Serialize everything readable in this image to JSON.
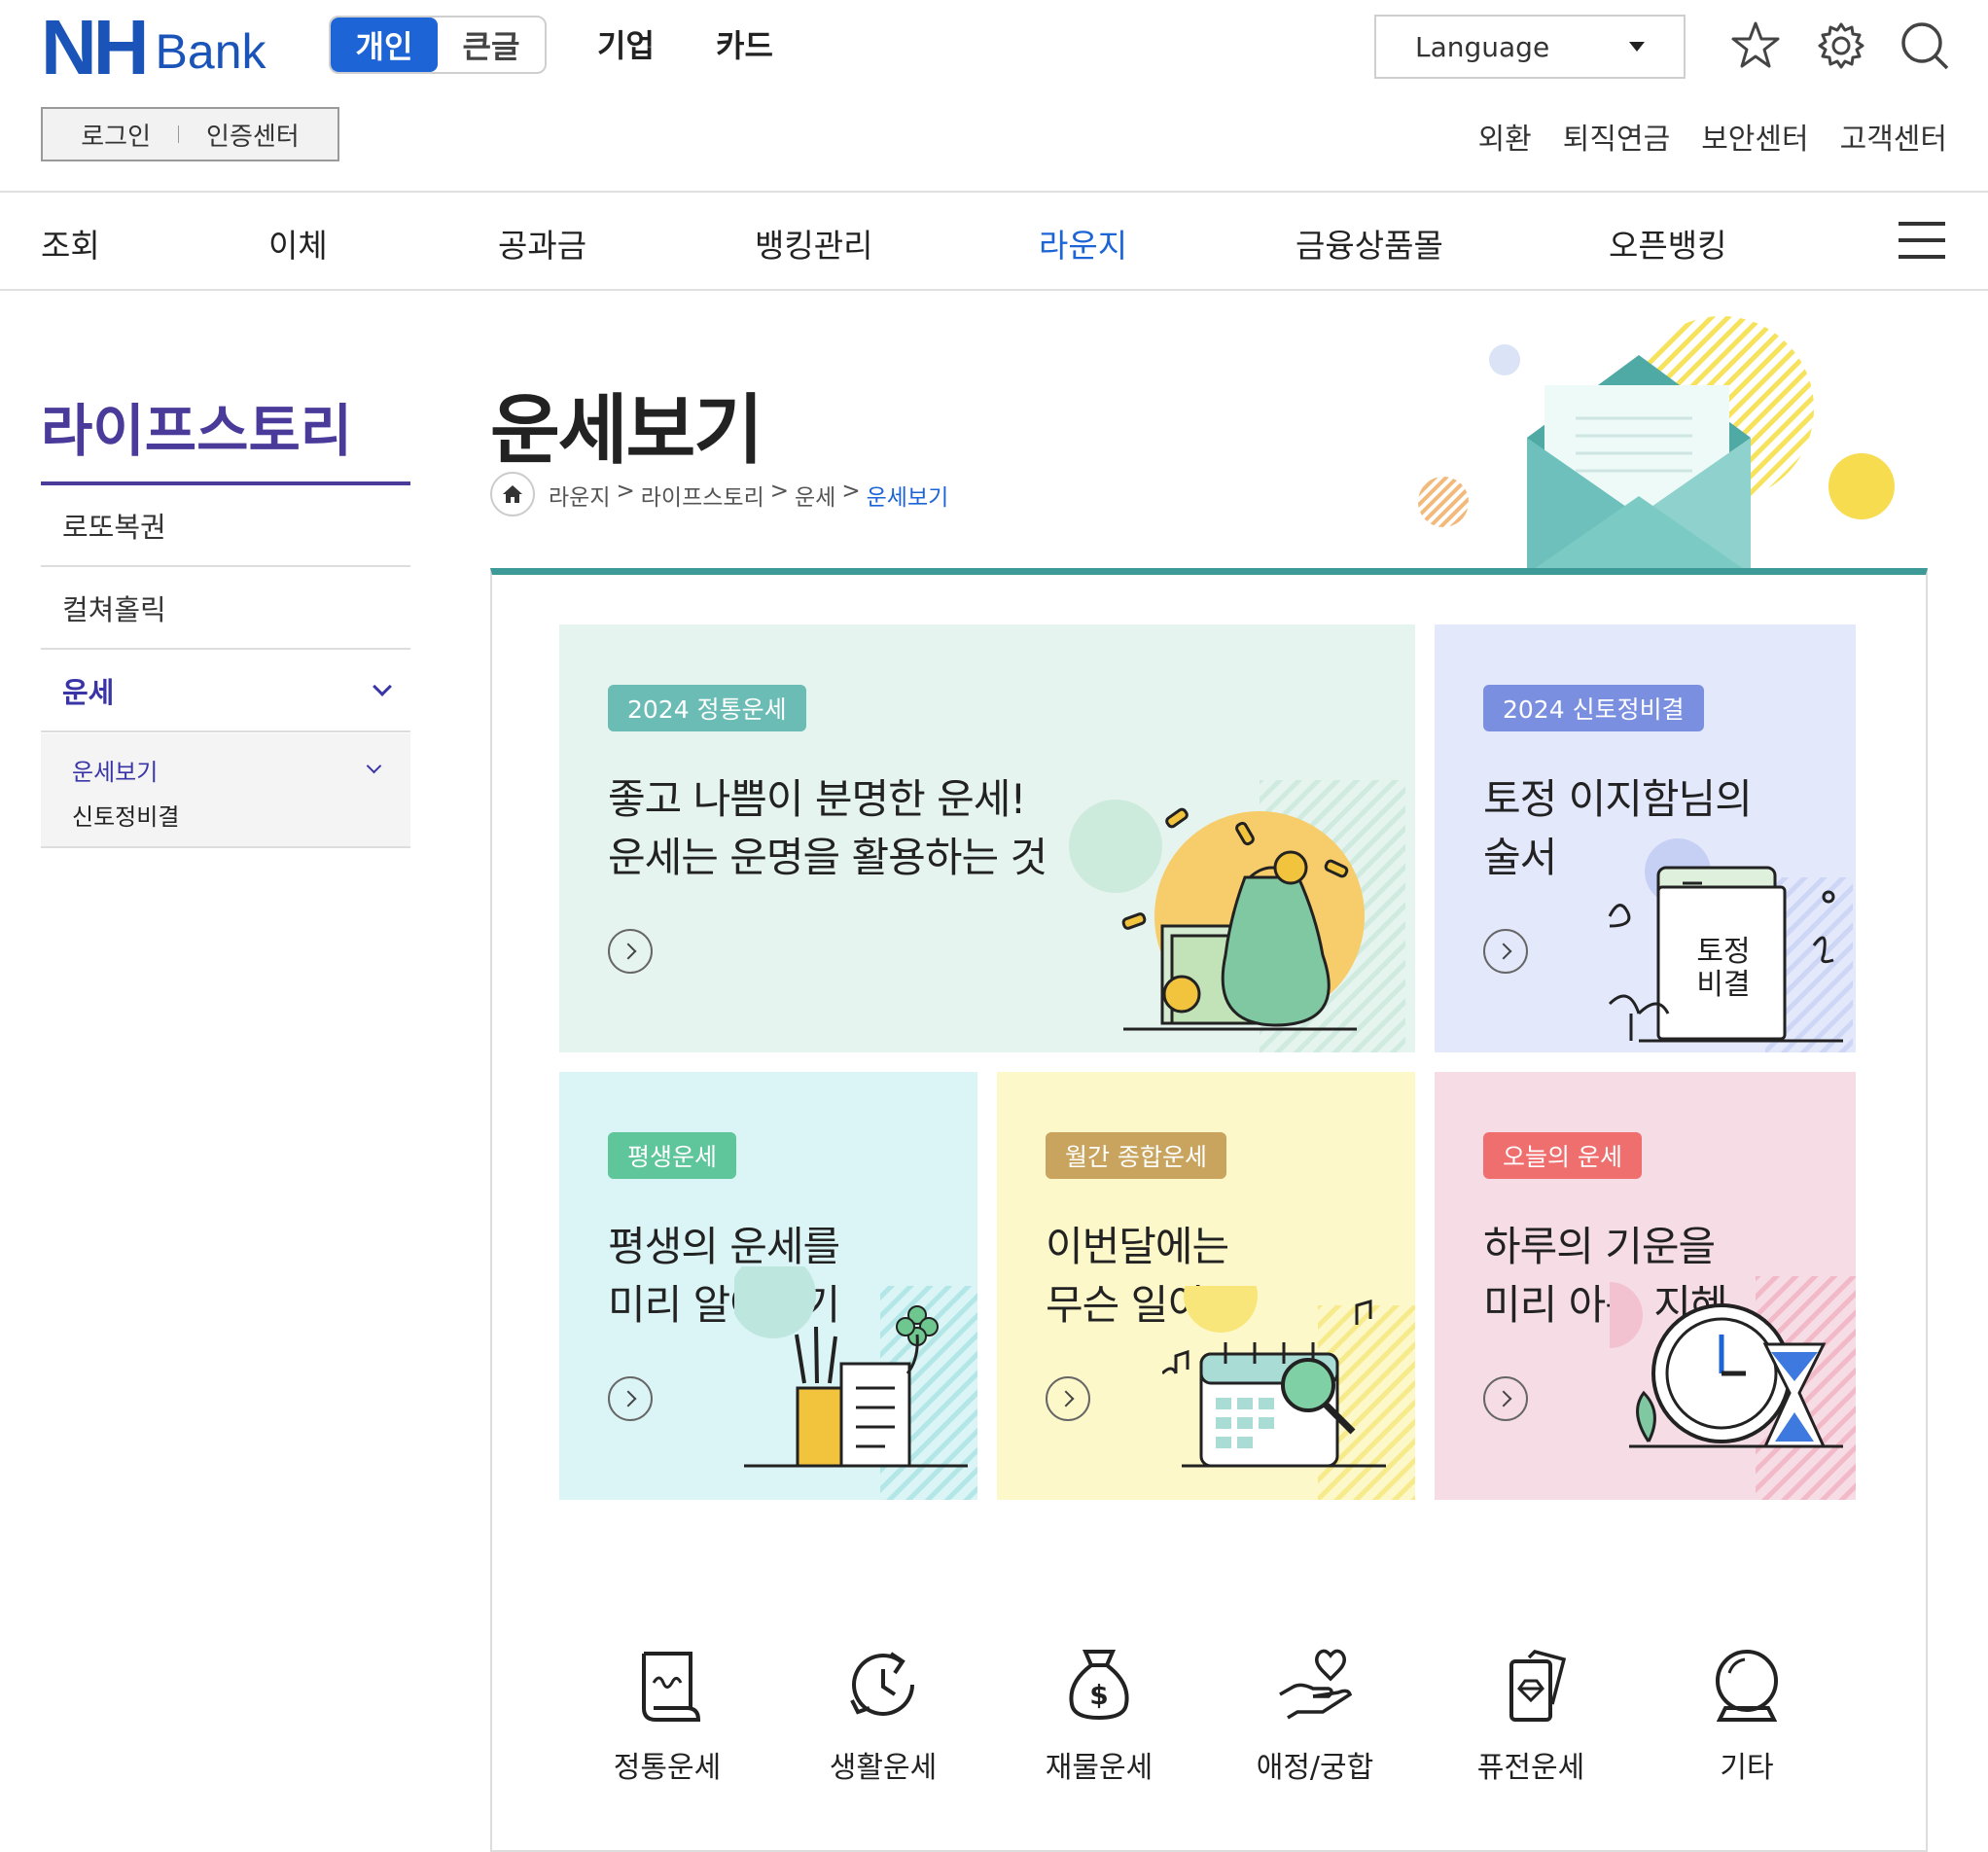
{
  "header": {
    "logo_nh": "NH",
    "logo_bank": "Bank",
    "modes": [
      "개인",
      "큰글"
    ],
    "top_links": [
      "기업",
      "카드"
    ],
    "language": "Language",
    "login": "로그인",
    "cert": "인증센터",
    "util_links": [
      "외환",
      "퇴직연금",
      "보안센터",
      "고객센터"
    ]
  },
  "gnb": [
    "조회",
    "이체",
    "공과금",
    "뱅킹관리",
    "라운지",
    "금융상품몰",
    "오픈뱅킹"
  ],
  "lnb": {
    "title": "라이프스토리",
    "items": [
      "로또복권",
      "컬쳐홀릭",
      "운세"
    ],
    "sub": [
      "운세보기",
      "신토정비결"
    ]
  },
  "page": {
    "title": "운세보기",
    "breadcrumb": [
      "라운지",
      "라이프스토리",
      "운세",
      "운세보기"
    ]
  },
  "cards": [
    {
      "tag": "2024 정통운세",
      "line1": "좋고 나쁨이 분명한 운세!",
      "line2": "운세는 운명을 활용하는 것",
      "tag_color": "#6cbcb6",
      "bg": "#e6f4ef"
    },
    {
      "tag": "2024 신토정비결",
      "line1": "토정 이지함님의",
      "line2": "술서",
      "tag_color": "#7b8fe0",
      "bg": "#e3e8fb",
      "book_line1": "토정",
      "book_line2": "비결"
    },
    {
      "tag": "평생운세",
      "line1": "평생의 운세를",
      "line2": "미리 알아보기",
      "tag_color": "#5fc59a",
      "bg": "#dbf5f6"
    },
    {
      "tag": "월간 종합운세",
      "line1": "이번달에는",
      "line2": "무슨 일이?",
      "tag_color": "#c9a45e",
      "bg": "#fdf8c9"
    },
    {
      "tag": "오늘의 운세",
      "line1": "하루의 기운을",
      "line2": "미리 아는 지혜",
      "tag_color": "#ef6f6f",
      "bg": "#f6dce4"
    }
  ],
  "categories": [
    {
      "label": "정통운세",
      "icon": "scroll-icon"
    },
    {
      "label": "생활운세",
      "icon": "refresh-clock-icon"
    },
    {
      "label": "재물운세",
      "icon": "money-bag-icon"
    },
    {
      "label": "애정/궁합",
      "icon": "heart-hand-icon"
    },
    {
      "label": "퓨전운세",
      "icon": "cards-icon"
    },
    {
      "label": "기타",
      "icon": "crystal-ball-icon"
    }
  ]
}
